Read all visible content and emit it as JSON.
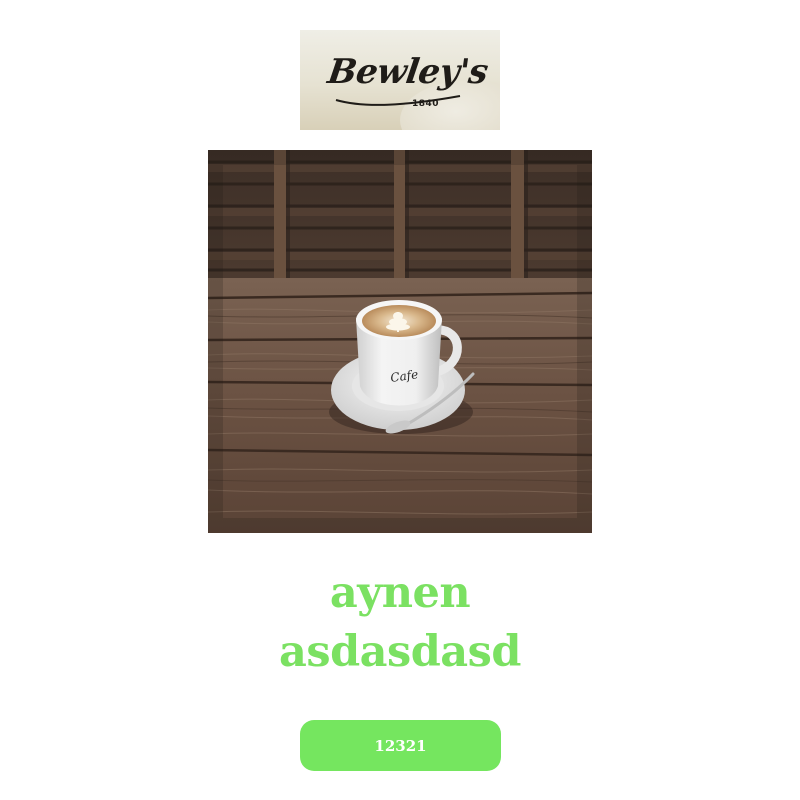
{
  "logo": {
    "brand": "Bewley's",
    "year": "1840"
  },
  "hero": {
    "cup_text": "Cafe"
  },
  "title": {
    "line1": "aynen",
    "line2": "asdasdasd"
  },
  "button": {
    "label": "12321"
  },
  "colors": {
    "accent": "#7be162",
    "button_bg": "#75e65f",
    "button_text": "#ffffff",
    "background": "#ffffff"
  }
}
